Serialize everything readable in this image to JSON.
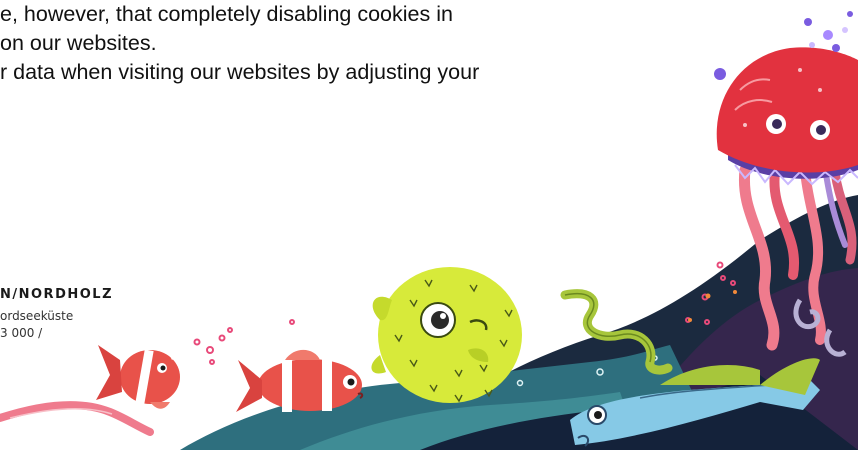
{
  "text": {
    "line1": "e, however, that completely disabling cookies in",
    "line2": " on our websites.",
    "line3": "r data when visiting our websites by adjusting your"
  },
  "address": {
    "brand": "N/NORDHOLZ",
    "line1": "ordseeküste",
    "line2": "3 000 /"
  },
  "colors": {
    "jelly_red": "#e2323f",
    "puffer_yellow": "#d7ea3a",
    "clownfish_red": "#e8524a",
    "blue_fish": "#86c9e6",
    "wave_dark": "#1b2a3f",
    "wave_teal": "#2e6f7e",
    "seaweed_green": "#a7c63b",
    "ribbon_pink": "#ef7b8d"
  }
}
